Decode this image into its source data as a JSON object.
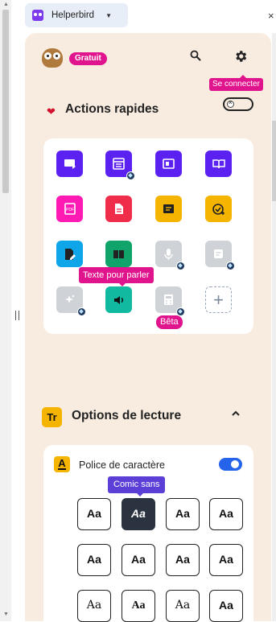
{
  "extension": {
    "name": "Helperbird"
  },
  "header": {
    "plan_badge": "Gratuit"
  },
  "tooltips": {
    "connect": "Se connecter",
    "speak": "Texte pour parler",
    "beta": "Bêta",
    "font_selected": "Comic sans"
  },
  "quick_actions": {
    "title": "Actions rapides",
    "enabled": false,
    "tiles": [
      {
        "name": "immersive-reader",
        "color": "#5b21f0",
        "premium": false
      },
      {
        "name": "reader-view",
        "color": "#5b21f0",
        "premium": true
      },
      {
        "name": "simplify-page",
        "color": "#5b21f0",
        "premium": false
      },
      {
        "name": "book-reader",
        "color": "#5b21f0",
        "premium": false
      },
      {
        "name": "pdf-reader",
        "color": "#ff1bb3",
        "premium": false
      },
      {
        "name": "document",
        "color": "#ef2d4a",
        "premium": false
      },
      {
        "name": "checklist",
        "color": "#f5b400",
        "premium": false
      },
      {
        "name": "spell-check",
        "color": "#f5b400",
        "premium": false
      },
      {
        "name": "edit-document",
        "color": "#0ea5e9",
        "premium": false
      },
      {
        "name": "dictionary",
        "color": "#10a36a",
        "premium": false
      },
      {
        "name": "dictation",
        "color": "#cfd3d8",
        "premium": true
      },
      {
        "name": "summarize",
        "color": "#cfd3d8",
        "premium": true
      },
      {
        "name": "ai-sparkles",
        "color": "#cfd3d8",
        "premium": true
      },
      {
        "name": "text-to-speech",
        "color": "#10b9a0",
        "premium": false
      },
      {
        "name": "calculator",
        "color": "#cfd3d8",
        "premium": true
      },
      {
        "name": "add-action",
        "color": "#ffffff",
        "premium": false
      }
    ]
  },
  "reading_options": {
    "title": "Options de lecture",
    "expanded": true,
    "font": {
      "label": "Police de caractère",
      "enabled": true,
      "sample": "Aa",
      "selected_index": 1,
      "count": 12
    }
  },
  "colors": {
    "brand_pink": "#e0148c",
    "panel_bg": "#f8ece0",
    "tooltip_purple": "#5b3fd6",
    "toggle_on": "#2563eb"
  }
}
